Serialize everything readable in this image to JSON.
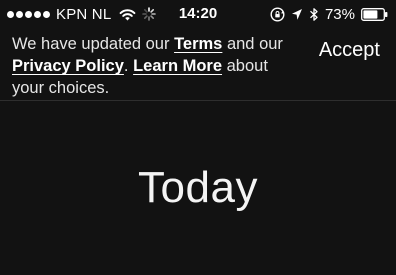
{
  "status_bar": {
    "signal_bars_filled": 5,
    "carrier": "KPN NL",
    "time": "14:20",
    "battery_percent": "73%",
    "battery_level": 0.73,
    "icons": [
      "signal-dots-icon",
      "wifi-icon",
      "activity-spinner-icon",
      "rotation-lock-icon",
      "location-arrow-icon",
      "bluetooth-icon",
      "battery-icon"
    ]
  },
  "banner": {
    "text_before_terms": "We have updated our ",
    "terms_link": "Terms",
    "text_between": " and our ",
    "privacy_link": "Privacy Policy",
    "text_after_privacy": ". ",
    "learn_more_link": "Learn More",
    "text_after": " about your choices.",
    "accept_label": "Accept"
  },
  "main": {
    "title": "Today"
  },
  "colors": {
    "background": "#121212",
    "text": "#ffffff",
    "divider": "#2e2e2e"
  }
}
